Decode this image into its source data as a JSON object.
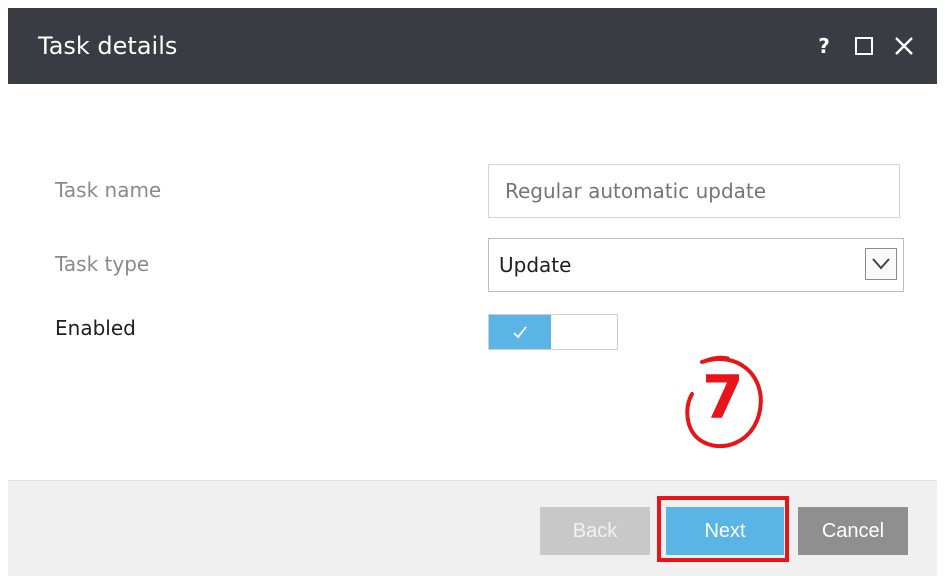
{
  "window": {
    "title": "Task details",
    "help_label": "?",
    "icons": [
      "maximize-icon",
      "close-icon"
    ]
  },
  "form": {
    "task_name": {
      "label": "Task name",
      "placeholder": "Regular automatic update"
    },
    "task_type": {
      "label": "Task type",
      "selected": "Update"
    },
    "enabled": {
      "label": "Enabled",
      "state": "on"
    }
  },
  "footer": {
    "back_label": "Back",
    "next_label": "Next",
    "cancel_label": "Cancel"
  },
  "annotation": {
    "step_number": "7"
  },
  "colors": {
    "titlebar": "#393c43",
    "accent": "#5ab4e5",
    "highlight": "#e8141a",
    "footer": "#f0f0f0"
  }
}
